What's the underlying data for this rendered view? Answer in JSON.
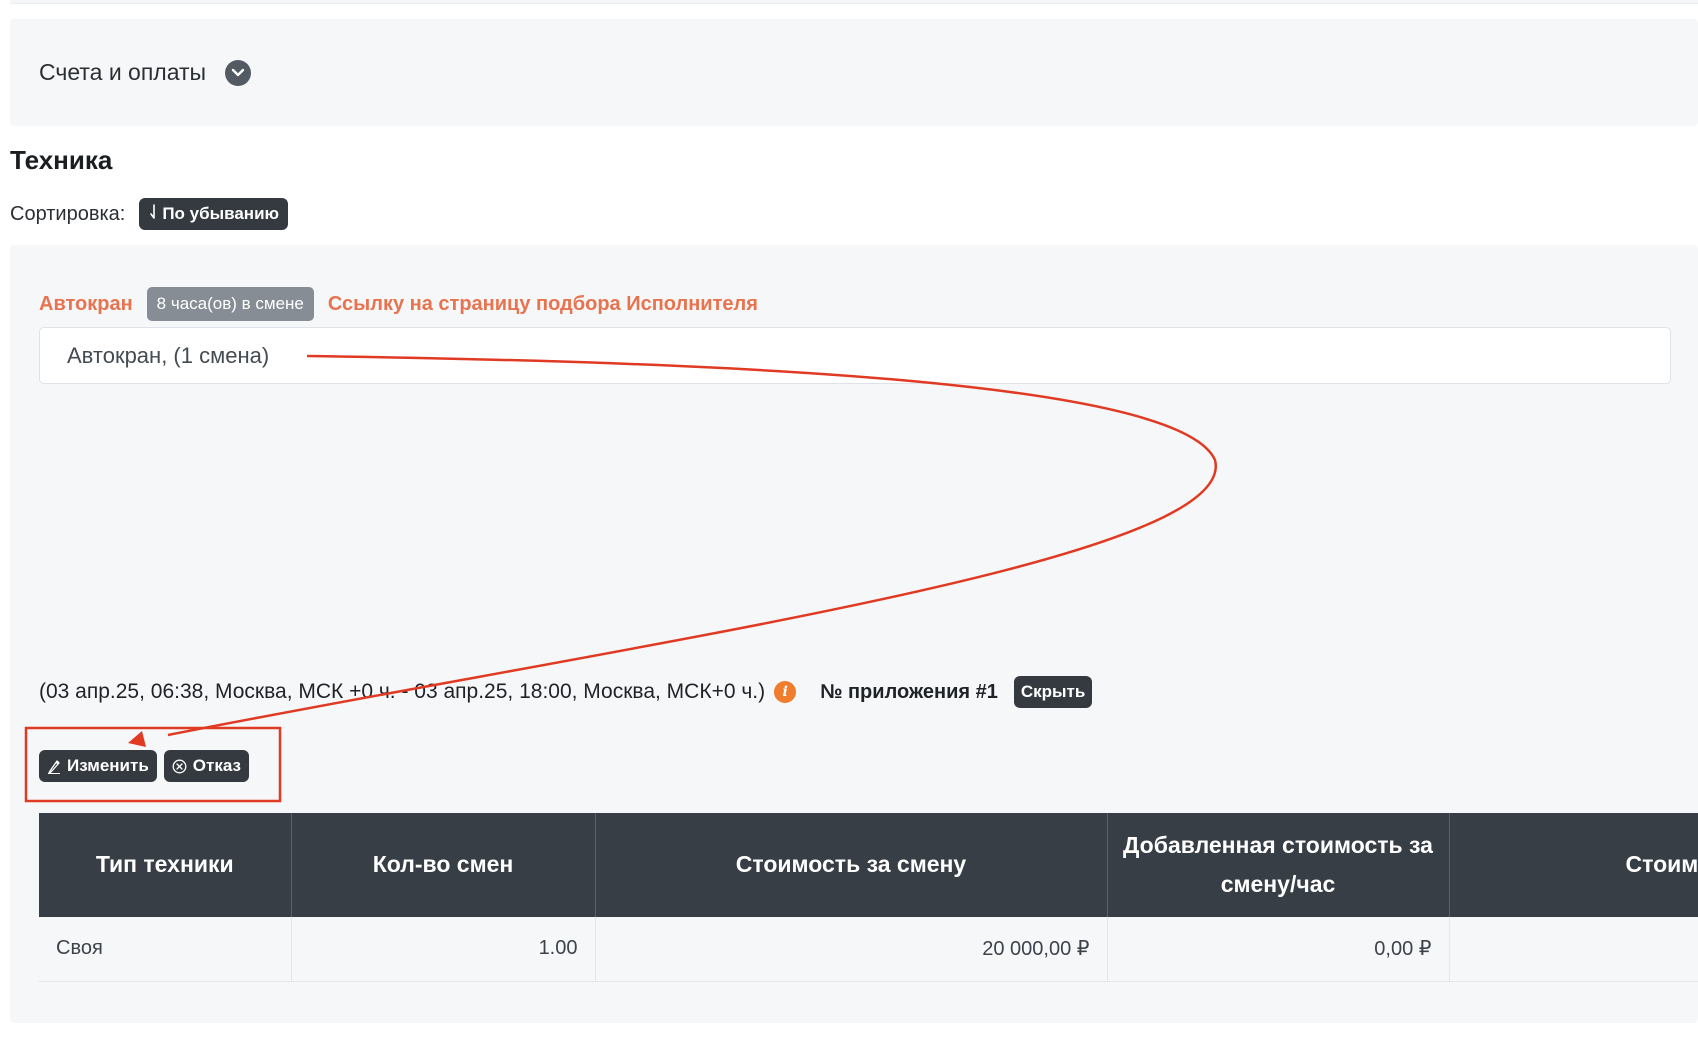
{
  "accordion": {
    "title": "Счета и оплаты",
    "toggle_icon": "chevron-down-icon"
  },
  "section": {
    "title": "Техника",
    "sort_label": "Сортировка:",
    "sort_button": "По убыванию",
    "sort_icon": "sort-descending-icon"
  },
  "card": {
    "vehicle_link": "Автокран",
    "hours_badge": "8 часа(ов) в смене",
    "executor_link": "Ссылку на страницу подбора Исполнителя",
    "vehicle_field": "Автокран,  (1 смена)",
    "period": "(03 апр.25, 06:38, Москва, МСК +0 ч. - 03 апр.25, 18:00, Москва, МСК+0 ч.)",
    "annex": "№ приложения #1",
    "hide_button": "Скрыть",
    "edit_button": "Изменить",
    "reject_button": "Отказ"
  },
  "table": {
    "headers": [
      "Тип техники",
      "Кол-во смен",
      "Стоимость за смену",
      "Добавленная стоимость за смену/час",
      "Стоим"
    ],
    "rows": [
      [
        "Своя",
        "1.00",
        "20 000,00 ₽",
        "0,00 ₽",
        ""
      ]
    ]
  },
  "colors": {
    "accent_orange": "#e8734f",
    "dark_button": "#343a40",
    "annotation_red": "#e03a23",
    "info_orange": "#ef7d2d"
  }
}
